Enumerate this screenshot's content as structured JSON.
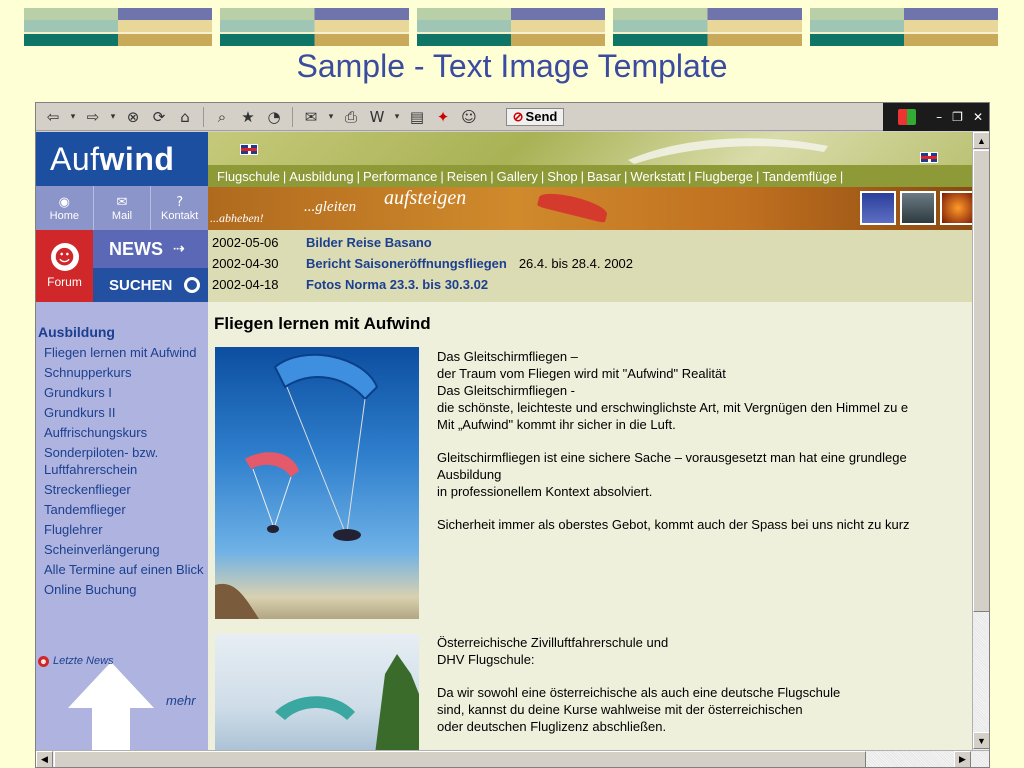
{
  "slide": {
    "title": "Sample - Text Image Template"
  },
  "toolbar": {
    "send_label": "Send"
  },
  "sidebar": {
    "logo_light": "Auf",
    "logo_bold": "wind",
    "home_label": "Home",
    "mail_label": "Mail",
    "kontakt_label": "Kontakt",
    "forum_label": "Forum",
    "news_label": "NEWS",
    "search_label": "SUCHEN",
    "section_title": "Ausbildung",
    "items": [
      {
        "label": "Fliegen lernen mit Aufwind"
      },
      {
        "label": "Schnupperkurs"
      },
      {
        "label": "Grundkurs I"
      },
      {
        "label": "Grundkurs II"
      },
      {
        "label": "Auffrischungskurs"
      },
      {
        "label": "Sonderpiloten- bzw. Luftfahrerschein"
      },
      {
        "label": "Streckenflieger"
      },
      {
        "label": "Tandemflieger"
      },
      {
        "label": "Fluglehrer"
      },
      {
        "label": "Scheinverlängerung"
      },
      {
        "label": "Alle Termine auf einen Blick"
      },
      {
        "label": "Online Buchung"
      }
    ],
    "latest_news_label": "Letzte News",
    "more_label": "mehr"
  },
  "menu": {
    "items": [
      "Flugschule",
      "Ausbildung",
      "Performance",
      "Reisen",
      "Gallery",
      "Shop",
      "Basar",
      "Werkstatt",
      "Flugberge",
      "Tandemflüge"
    ]
  },
  "banner": {
    "word1": "...abheben!",
    "word2": "...gleiten",
    "word3": "aufsteigen"
  },
  "news": [
    {
      "date": "2002-05-06",
      "title": "Bilder Reise Basano",
      "extra": ""
    },
    {
      "date": "2002-04-30",
      "title": "Bericht Saisoneröffnungsfliegen",
      "extra": "26.4. bis 28.4. 2002"
    },
    {
      "date": "2002-04-18",
      "title": "Fotos Norma 23.3. bis 30.3.02",
      "extra": ""
    }
  ],
  "content": {
    "heading": "Fliegen lernen mit Aufwind",
    "para1": "Das Gleitschirmfliegen –\nder Traum vom Fliegen wird mit \"Aufwind\" Realität\nDas Gleitschirmfliegen -\ndie schönste, leichteste und erschwinglichste Art, mit Vergnügen den Himmel zu e\nMit „Aufwind\" kommt ihr sicher in die Luft.",
    "para2": "Gleitschirmfliegen ist eine sichere Sache – vorausgesetzt man hat eine grundlege\nAusbildung\nin professionellem Kontext absolviert.",
    "para3": "Sicherheit immer als oberstes Gebot, kommt auch der Spass bei uns nicht zu kurz",
    "para4": "Österreichische Zivilluftfahrerschule und\nDHV Flugschule:",
    "para5": "Da wir sowohl eine österreichische als auch eine deutsche Flugschule\nsind, kannst du deine Kurse wahlweise mit der österreichischen\noder deutschen Fluglizenz abschließen."
  },
  "colors": {
    "slide_background": "#ffffd6",
    "title_color": "#3a4ba0",
    "site_blue": "#1c4fa0",
    "menu_green": "#8e9a37"
  }
}
